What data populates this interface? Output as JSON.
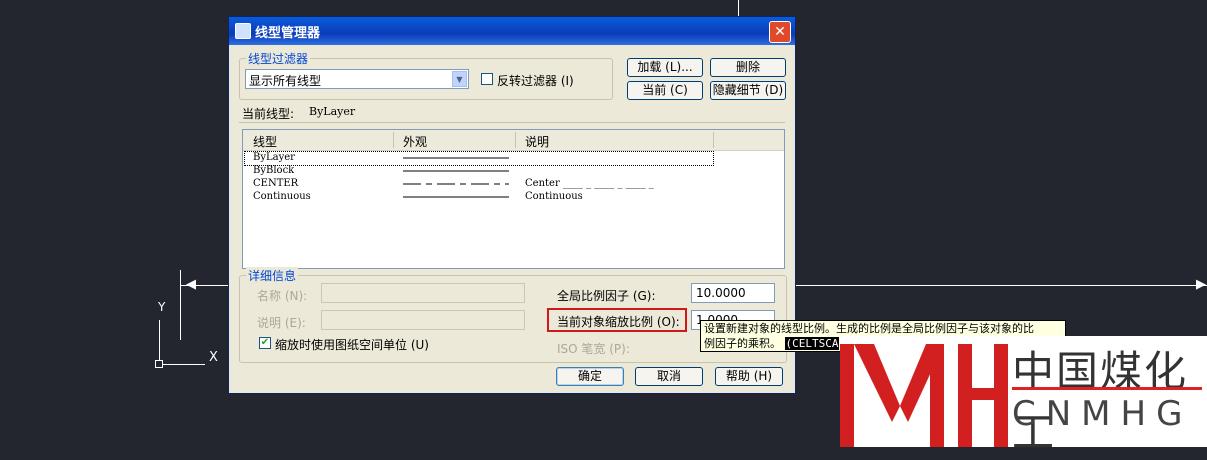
{
  "dialog": {
    "title": "线型管理器",
    "filter_group_title": "线型过滤器",
    "filter_value": "显示所有线型",
    "invert_filter_label": "反转过滤器 (I)",
    "load_button": "加载 (L)...",
    "delete_button": "删除",
    "current_button": "当前 (C)",
    "hide_details_button": "隐藏细节 (D)",
    "current_linetype_label": "当前线型:",
    "current_linetype_value": "ByLayer",
    "columns": {
      "linetype": "线型",
      "appearance": "外观",
      "description": "说明"
    },
    "rows": [
      {
        "name": "ByLayer",
        "description": ""
      },
      {
        "name": "ByBlock",
        "description": ""
      },
      {
        "name": "CENTER",
        "description": "Center ____ _ ____ _ ____ _"
      },
      {
        "name": "Continuous",
        "description": "Continuous"
      }
    ],
    "details_group_title": "详细信息",
    "name_label": "名称 (N):",
    "desc_label": "说明 (E):",
    "paper_units_label": "缩放时使用图纸空间单位 (U)",
    "global_scale_label": "全局比例因子 (G):",
    "global_scale_value": "10.0000",
    "current_scale_label": "当前对象缩放比例 (O):",
    "current_scale_value": "1.0000",
    "iso_pen_label": "ISO 笔宽 (P):",
    "ok_button": "确定",
    "cancel_button": "取消",
    "help_button": "帮助 (H)"
  },
  "tooltip": {
    "line1": "设置新建对象的线型比例。生成的比例是全局比例因子与该对象的比",
    "line2": "例因子的乘积。",
    "code": "(CELTSCA"
  },
  "cad": {
    "y_axis": "Y",
    "x_axis": "X"
  },
  "watermark": {
    "chinese": "中国煤化工",
    "english": "CNMHG",
    "brand_color": "#d22020"
  }
}
